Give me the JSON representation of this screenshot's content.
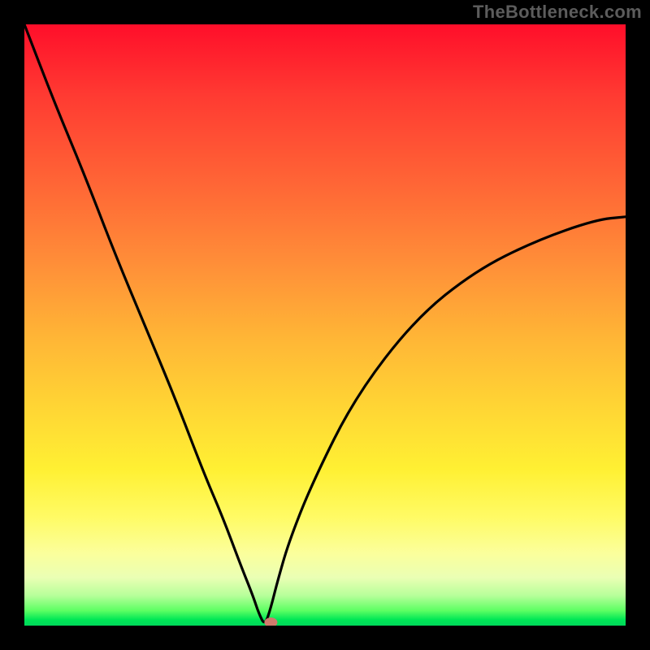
{
  "attribution": "TheBottleneck.com",
  "colors": {
    "frame_bg": "#000000",
    "gradient_top": "#ff0e2a",
    "gradient_bottom": "#00d85a",
    "curve": "#000000",
    "marker": "#cf7a6c",
    "attribution_text": "#5c5c5c"
  },
  "chart_data": {
    "type": "line",
    "title": "",
    "xlabel": "",
    "ylabel": "",
    "xlim": [
      0,
      100
    ],
    "ylim": [
      0,
      100
    ],
    "notch_x": 40,
    "x": [
      0,
      5,
      10,
      15,
      20,
      25,
      30,
      33,
      36,
      38,
      39,
      40,
      41,
      42,
      44,
      48,
      55,
      65,
      75,
      85,
      95,
      100
    ],
    "values": [
      100,
      87,
      75,
      62,
      50,
      38,
      25,
      18,
      10,
      5,
      2,
      0,
      3,
      7,
      14,
      24,
      38,
      51,
      59,
      64,
      67.5,
      68
    ],
    "marker_point": {
      "x": 41,
      "y": 0
    },
    "legend": [],
    "grid": false
  }
}
